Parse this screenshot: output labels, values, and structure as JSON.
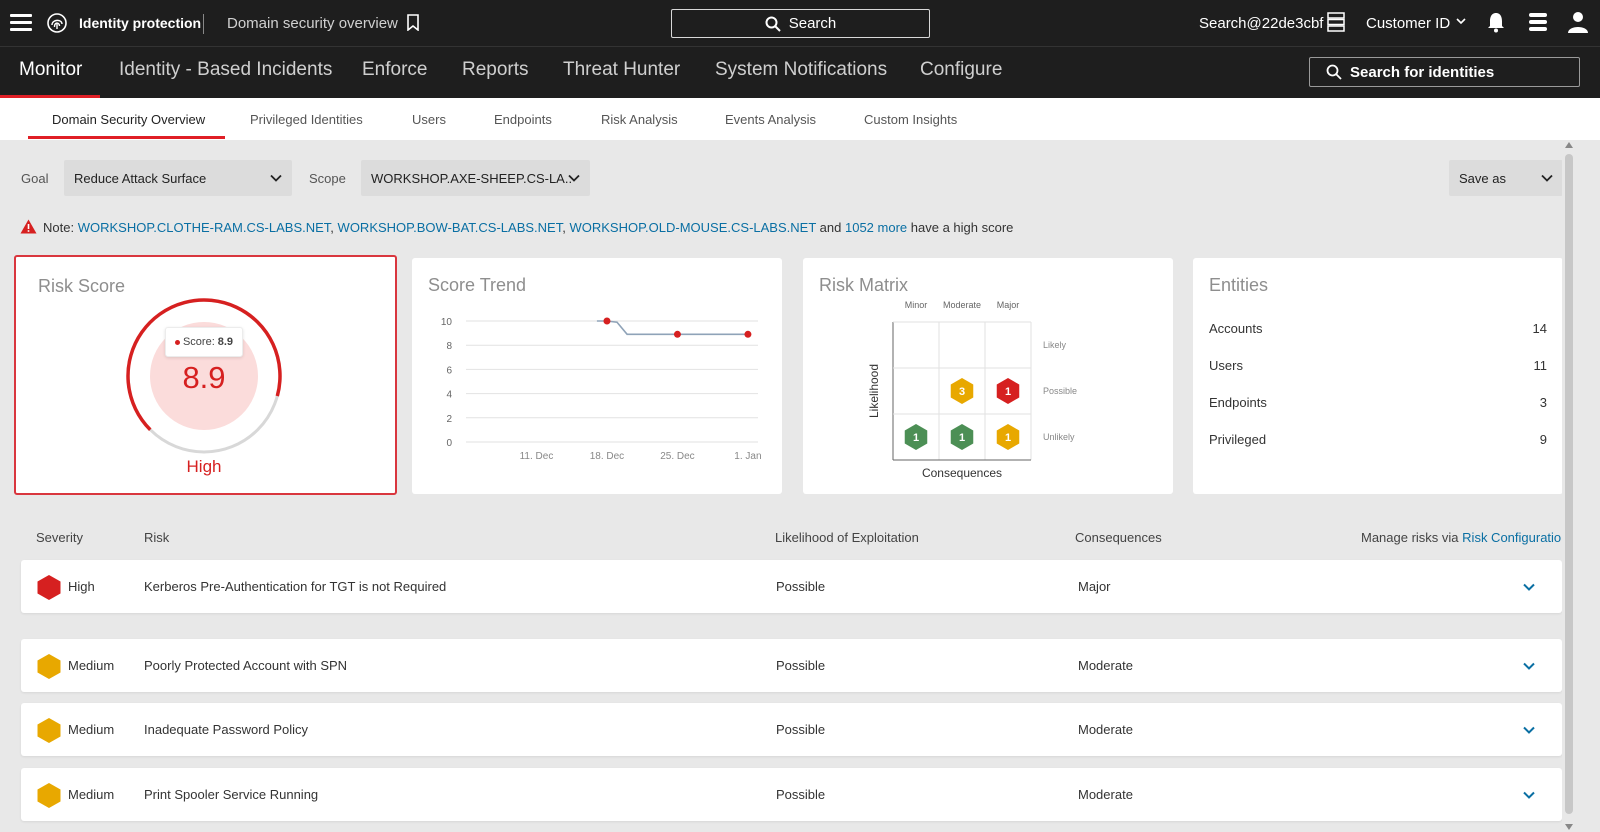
{
  "topbar": {
    "product": "Identity protection",
    "breadcrumb": "Domain security overview",
    "search_label": "Search",
    "user": "Search@22de3cbf",
    "customer": "Customer ID"
  },
  "nav": {
    "items": [
      "Monitor",
      "Identity - Based Incidents",
      "Enforce",
      "Reports",
      "Threat Hunter",
      "System Notifications",
      "Configure"
    ],
    "identity_search": "Search for identities"
  },
  "subtabs": [
    "Domain Security Overview",
    "Privileged Identities",
    "Users",
    "Endpoints",
    "Risk Analysis",
    "Events Analysis",
    "Custom Insights"
  ],
  "filters": {
    "goal_label": "Goal",
    "goal_value": "Reduce Attack Surface",
    "scope_label": "Scope",
    "scope_value": "WORKSHOP.AXE-SHEEP.CS-LA..",
    "save_as": "Save as"
  },
  "note": {
    "prefix": "Note:",
    "links": [
      "WORKSHOP.CLOTHE-RAM.CS-LABS.NET",
      "WORKSHOP.BOW-BAT.CS-LABS.NET",
      "WORKSHOP.OLD-MOUSE.CS-LABS.NET"
    ],
    "and": "and",
    "more": "1052 more",
    "suffix": "have a high score",
    "sep": ","
  },
  "risk_score": {
    "title": "Risk Score",
    "tooltip_label": "Score:",
    "tooltip_value": "8.9",
    "value": "8.9",
    "level": "High",
    "score_out_of_10": 8.9
  },
  "score_trend": {
    "title": "Score Trend"
  },
  "risk_matrix": {
    "title": "Risk Matrix",
    "columns": [
      "Minor",
      "Moderate",
      "Major"
    ],
    "rows": [
      "Likely",
      "Possible",
      "Unlikely"
    ],
    "ylabel": "Likelihood",
    "xlabel": "Consequences",
    "cells": [
      {
        "row": "Possible",
        "col": "Moderate",
        "count": "3",
        "color": "#e8a800"
      },
      {
        "row": "Possible",
        "col": "Major",
        "count": "1",
        "color": "#d62020"
      },
      {
        "row": "Unlikely",
        "col": "Minor",
        "count": "1",
        "color": "#4c8f55"
      },
      {
        "row": "Unlikely",
        "col": "Moderate",
        "count": "1",
        "color": "#4c8f55"
      },
      {
        "row": "Unlikely",
        "col": "Major",
        "count": "1",
        "color": "#e8a800"
      }
    ]
  },
  "entities": {
    "title": "Entities",
    "items": [
      {
        "label": "Accounts",
        "value": "14"
      },
      {
        "label": "Users",
        "value": "11"
      },
      {
        "label": "Endpoints",
        "value": "3"
      },
      {
        "label": "Privileged",
        "value": "9"
      }
    ]
  },
  "table": {
    "headers": {
      "severity": "Severity",
      "risk": "Risk",
      "likelihood": "Likelihood of Exploitation",
      "consequences": "Consequences",
      "manage_prefix": "Manage risks via",
      "manage_link": "Risk Configuration"
    },
    "rows": [
      {
        "severity": "High",
        "color": "#d62020",
        "risk": "Kerberos Pre-Authentication for TGT is not Required",
        "likelihood": "Possible",
        "consequences": "Major"
      },
      {
        "severity": "Medium",
        "color": "#e8a800",
        "risk": "Poorly Protected Account with SPN",
        "likelihood": "Possible",
        "consequences": "Moderate"
      },
      {
        "severity": "Medium",
        "color": "#e8a800",
        "risk": "Inadequate Password Policy",
        "likelihood": "Possible",
        "consequences": "Moderate"
      },
      {
        "severity": "Medium",
        "color": "#e8a800",
        "risk": "Print Spooler Service Running",
        "likelihood": "Possible",
        "consequences": "Moderate"
      }
    ]
  },
  "chart_data": {
    "type": "line",
    "title": "Score Trend",
    "x_ticks": [
      "11. Dec",
      "18. Dec",
      "25. Dec",
      "1. Jan"
    ],
    "y_ticks": [
      "0",
      "2",
      "4",
      "6",
      "8",
      "10"
    ],
    "ylim": [
      0,
      10
    ],
    "grid": true,
    "series": [
      {
        "color": "#8fa3b8",
        "marker_color": "#d62020",
        "x": [
          "Dec 17",
          "Dec 18",
          "Dec 19",
          "Dec 20",
          "Dec 25",
          "Jan 1"
        ],
        "y": [
          10,
          10,
          9.9,
          8.9,
          8.9,
          8.9
        ],
        "markers": [
          1,
          4,
          5
        ]
      }
    ]
  }
}
